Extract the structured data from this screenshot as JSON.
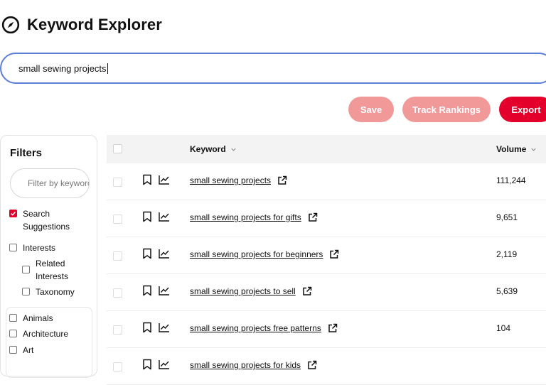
{
  "header": {
    "title": "Keyword Explorer",
    "icon": "compass-icon"
  },
  "search": {
    "value": "small sewing projects"
  },
  "actions": {
    "save": "Save",
    "track": "Track Rankings",
    "export": "Export"
  },
  "filters": {
    "title": "Filters",
    "input_placeholder": "Filter by keyword",
    "search_suggestions": "Search Suggestions",
    "interests": "Interests",
    "related_interests": "Related Interests",
    "taxonomy": "Taxonomy",
    "categories": [
      "Animals",
      "Architecture",
      "Art"
    ]
  },
  "table": {
    "col_keyword": "Keyword",
    "col_volume": "Volume",
    "rows": [
      {
        "keyword": "small sewing projects",
        "volume": "111,244"
      },
      {
        "keyword": "small sewing projects for gifts",
        "volume": "9,651"
      },
      {
        "keyword": "small sewing projects for beginners",
        "volume": "2,119"
      },
      {
        "keyword": "small sewing projects to sell",
        "volume": "5,639"
      },
      {
        "keyword": "small sewing projects free patterns",
        "volume": "104"
      },
      {
        "keyword": "small sewing projects for kids",
        "volume": ""
      }
    ]
  },
  "colors": {
    "accent": "#e3002b",
    "accent_light": "#f19999",
    "search_border": "#5b7fd6"
  }
}
